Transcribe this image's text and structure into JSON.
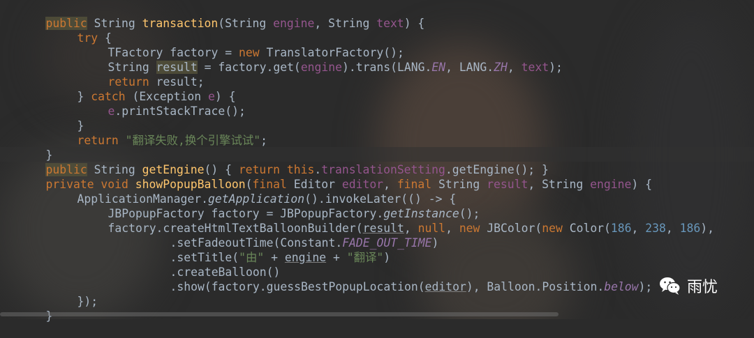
{
  "colors": {
    "keyword": "#cc7832",
    "param": "#94558d",
    "string": "#6a8759",
    "function": "#ffc66d",
    "number": "#6897bb",
    "text": "#a9b7c6",
    "constant": "#9876aa"
  },
  "code": {
    "l1": {
      "kw": "public",
      "a": " String ",
      "fn": "transaction",
      "b": "(String ",
      "p1": "engine",
      "c": ", String ",
      "p2": "text",
      "d": ") {"
    },
    "l2": {
      "kw": "try",
      "a": " {"
    },
    "l3": {
      "a": "TFactory factory = ",
      "kw": "new",
      "b": " TranslatorFactory();"
    },
    "l4": {
      "a": "String ",
      "v": "result",
      "b": " = factory.get(",
      "p1": "engine",
      "c": ").trans(LANG.",
      "c1": "EN",
      "d": ", LANG.",
      "c2": "ZH",
      "e": ", ",
      "p2": "text",
      "f": ");"
    },
    "l5": {
      "kw": "return",
      "a": " result;"
    },
    "l6": {
      "a": "} ",
      "kw": "catch",
      "b": " (Exception ",
      "p": "e",
      "c": ") {"
    },
    "l7": {
      "p": "e",
      "a": ".printStackTrace();"
    },
    "l8": {
      "a": "}"
    },
    "l9": {
      "kw": "return",
      "a": " ",
      "s": "\"翻译失败,换个引擎试试\"",
      "b": ";"
    },
    "l10": {
      "a": "}"
    },
    "l11": {
      "kw": "public",
      "a": " String ",
      "fn": "getEngine",
      "b": "() { ",
      "kw2": "return",
      "c": " ",
      "kw3": "this",
      "d": ".",
      "v": "translationSetting",
      "e": ".getEngine(); }"
    },
    "l12": {
      "kw": "private void",
      "a": " ",
      "fn": "showPopupBalloon",
      "b": "(",
      "kw2": "final",
      "c": " Editor ",
      "p1": "editor",
      "d": ", ",
      "kw3": "final",
      "e": " String ",
      "p2": "result",
      "f": ", String ",
      "p3": "engine",
      "g": ") {"
    },
    "l13": {
      "a": "ApplicationManager.",
      "it": "getApplication",
      "b": "().invokeLater(() -> {"
    },
    "l14": {
      "a": "JBPopupFactory factory = JBPopupFactory.",
      "it": "getInstance",
      "b": "();"
    },
    "l15": {
      "a": "factory.createHtmlTextBalloonBuilder(",
      "u": "result",
      "b": ", ",
      "kw": "null",
      "c": ", ",
      "kw2": "new",
      "d": " JBColor(",
      "kw3": "new",
      "e": " Color(",
      "n1": "186",
      "f": ", ",
      "n2": "238",
      "g": ", ",
      "n3": "186",
      "h": "),"
    },
    "l16": {
      "a": ".setFadeoutTime(Constant.",
      "c": "FADE_OUT_TIME",
      "b": ")"
    },
    "l17": {
      "a": ".setTitle(",
      "s1": "\"由\"",
      "b": " + ",
      "u": "engine",
      "c": " + ",
      "s2": "\"翻译\"",
      "d": ")"
    },
    "l18": {
      "a": ".createBalloon()"
    },
    "l19": {
      "a": ".show(factory.guessBestPopupLocation(",
      "u": "editor",
      "b": "), Balloon.Position.",
      "c": "below",
      "d": ");"
    },
    "l20": {
      "a": "});"
    },
    "l21": {
      "a": "}"
    }
  },
  "watermark": {
    "icon": "wechat-icon",
    "text": "雨忧"
  }
}
